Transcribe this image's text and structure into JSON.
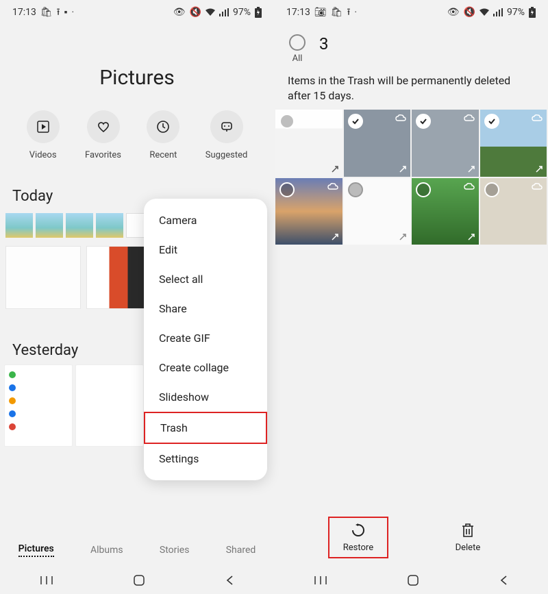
{
  "status": {
    "time": "17:13",
    "battery": "97%"
  },
  "leftScreen": {
    "title": "Pictures",
    "categories": [
      {
        "id": "videos",
        "label": "Videos"
      },
      {
        "id": "favorites",
        "label": "Favorites"
      },
      {
        "id": "recent",
        "label": "Recent"
      },
      {
        "id": "suggested",
        "label": "Suggested"
      }
    ],
    "sections": {
      "today": "Today",
      "yesterday": "Yesterday"
    },
    "tabs": {
      "pictures": "Pictures",
      "albums": "Albums",
      "stories": "Stories",
      "shared": "Shared"
    },
    "menu": {
      "camera": "Camera",
      "edit": "Edit",
      "selectAll": "Select all",
      "share": "Share",
      "createGif": "Create GIF",
      "createCollage": "Create collage",
      "slideshow": "Slideshow",
      "trash": "Trash",
      "settings": "Settings"
    }
  },
  "rightScreen": {
    "selectedCount": "3",
    "allLabel": "All",
    "trashNote": "Items in the Trash will be permanently deleted after 15 days.",
    "actions": {
      "restore": "Restore",
      "delete": "Delete"
    }
  }
}
